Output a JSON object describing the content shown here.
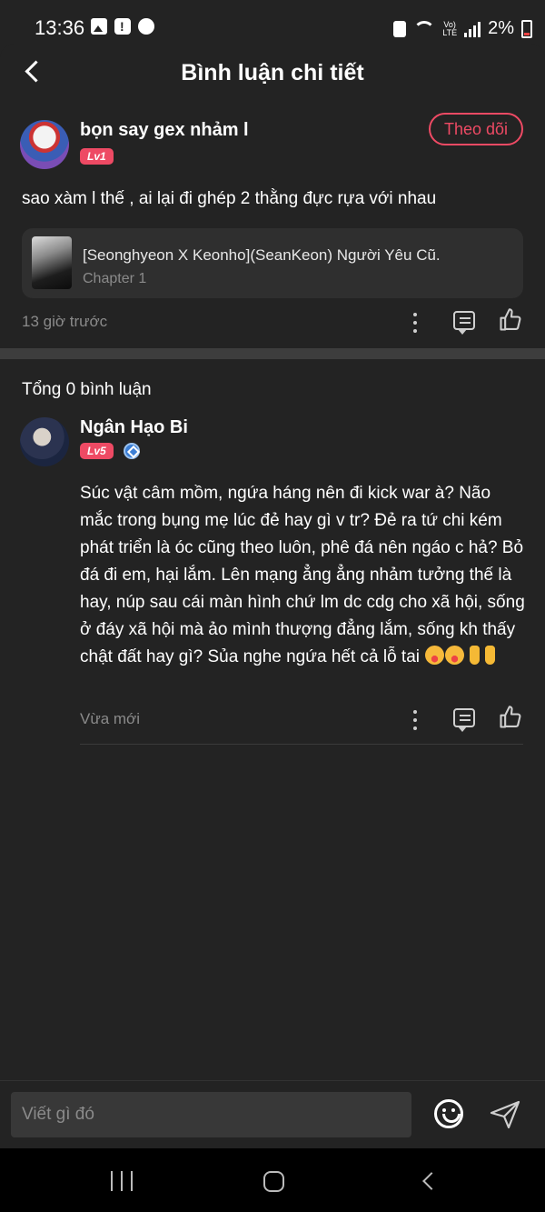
{
  "status_bar": {
    "time": "13:36",
    "network": "LTE",
    "volte": "Vo)",
    "battery": "2%"
  },
  "header": {
    "title": "Bình luận chi tiết"
  },
  "post": {
    "username": "bọn say gex nhảm l",
    "level": "Lv1",
    "follow_label": "Theo dõi",
    "text": "sao xàm l thế , ai lại đi ghép 2 thằng đực rựa với nhau",
    "story": {
      "title": "[Seonghyeon X Keonho](SeanKeon) Người Yêu Cũ.",
      "chapter": "Chapter 1"
    },
    "time": "13 giờ trước"
  },
  "comments_total": "Tổng 0 bình luận",
  "reply": {
    "username": "Ngân Hạo Bi",
    "level": "Lv5",
    "text": "Súc vật câm mồm, ngứa háng nên đi kick war à? Não mắc trong bụng mẹ lúc đẻ hay gì v tr? Đẻ ra tứ chi kém phát triển là óc cũng theo luôn, phê đá nên ngáo c hả? Bỏ đá đi em, hại lắm. Lên mạng ẳng ẳng nhảm tưởng thế là hay, núp sau cái màn hình chứ lm dc cdg cho xã hội, sống ở đáy xã hội mà ảo mình thượng đẳng lắm, sống kh thấy chật đất hay gì? Sủa nghe ngứa hết cả lỗ tai",
    "time": "Vừa mới"
  },
  "input": {
    "placeholder": "Viết gì đó"
  },
  "icons": [
    "back-icon",
    "more-icon",
    "comment-icon",
    "like-icon",
    "verified-icon",
    "emoji-icon",
    "send-icon",
    "recents-icon",
    "home-icon",
    "nav-back-icon"
  ],
  "colors": {
    "background": "#232323",
    "accent": "#ee4a64",
    "card": "#2f2f2f",
    "muted": "#8a8a8a"
  }
}
